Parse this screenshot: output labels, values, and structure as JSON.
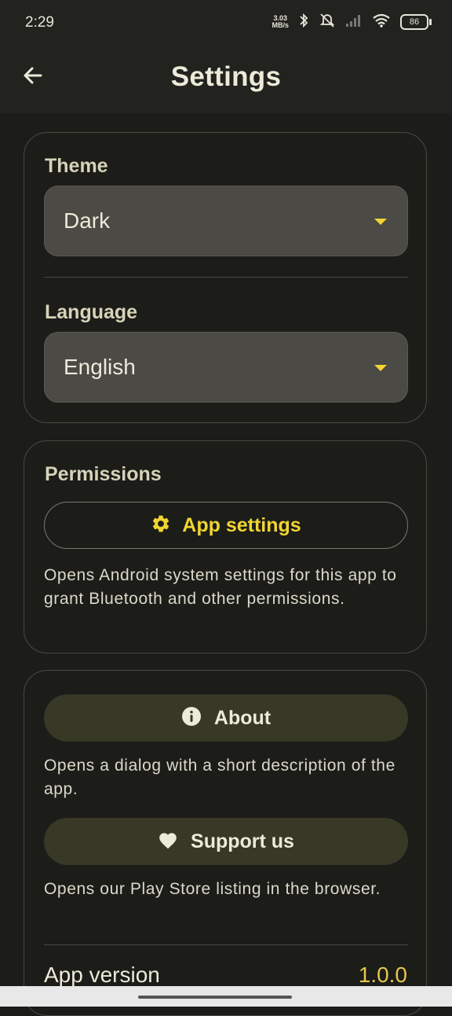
{
  "status": {
    "time": "2:29",
    "net_speed_value": "3.03",
    "net_speed_unit": "MB/s",
    "battery": "86"
  },
  "header": {
    "title": "Settings"
  },
  "appearance": {
    "theme_label": "Theme",
    "theme_value": "Dark",
    "language_label": "Language",
    "language_value": "English"
  },
  "permissions": {
    "label": "Permissions",
    "button_label": "App settings",
    "description": "Opens Android system settings for this app to grant Bluetooth and other permissions."
  },
  "about": {
    "about_button": "About",
    "about_description": "Opens a dialog with a short description of the app.",
    "support_button": "Support us",
    "support_description": "Opens our Play Store listing in the browser.",
    "version_label": "App version",
    "version_value": "1.0.0"
  },
  "colors": {
    "accent": "#f0d431",
    "background": "#1c1c19",
    "tonal_button": "#373826"
  }
}
